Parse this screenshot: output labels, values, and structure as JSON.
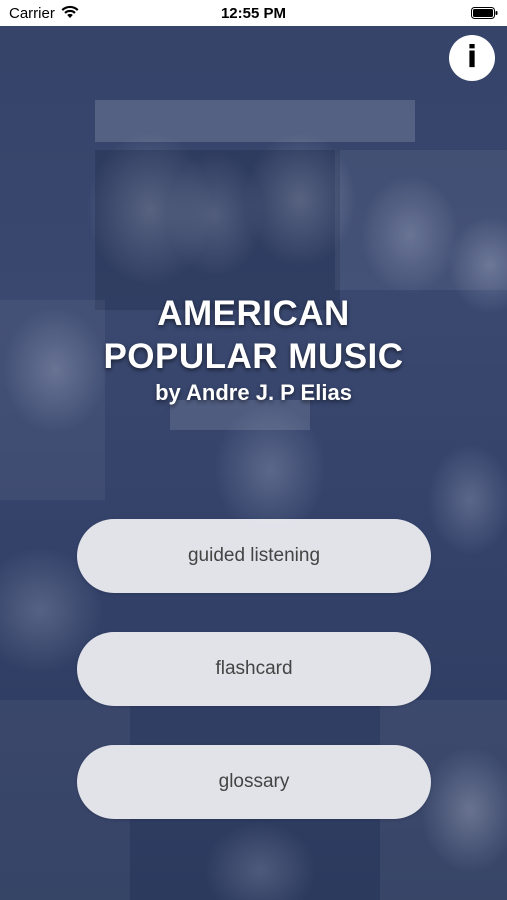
{
  "status_bar": {
    "carrier": "Carrier",
    "time": "12:55 PM",
    "icons": [
      "wifi-icon",
      "battery-icon"
    ]
  },
  "info_button": {
    "label": "i",
    "icon": "info-icon"
  },
  "title": {
    "line1": "AMERICAN",
    "line2": "POPULAR MUSIC",
    "byline": "by Andre J. P Elias"
  },
  "menu": {
    "guided_listening": "guided listening",
    "flashcard": "flashcard",
    "glossary": "glossary"
  },
  "colors": {
    "background": "#34426a",
    "button_bg": "#ebecf0",
    "button_text": "#444444",
    "title_text": "#ffffff"
  }
}
